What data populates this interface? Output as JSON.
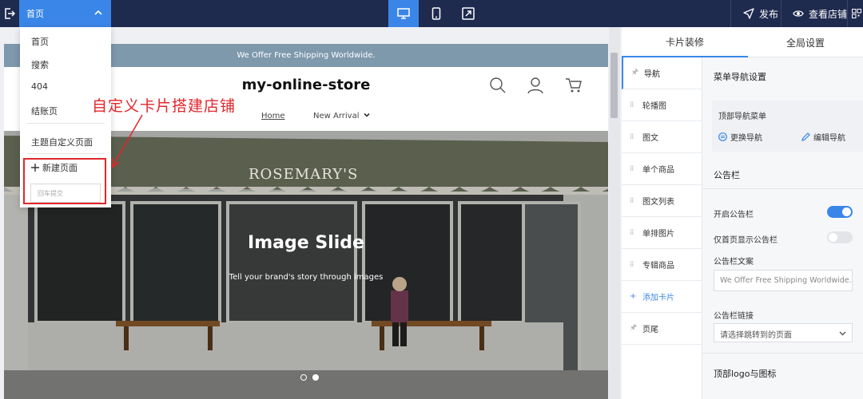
{
  "topbar": {
    "current_page": "首页",
    "publish_label": "发布",
    "view_store_label": "查看店铺",
    "icons": {
      "exit": "exit-icon",
      "desktop": "desktop-icon",
      "mobile": "mobile-icon",
      "fullscreen": "fullscreen-icon",
      "publish": "send-icon",
      "view": "eye-icon",
      "qr": "qr-icon"
    }
  },
  "dropdown": {
    "items": [
      "首页",
      "搜索",
      "404",
      "结账页"
    ],
    "theme_custom": "主题自定义页面",
    "new_page": "新建页面",
    "new_page_placeholder": "回车提交"
  },
  "annotation": "自定义卡片搭建店铺",
  "preview": {
    "announcement": "We Offer Free Shipping Worldwide.",
    "store_name": "my-online-store",
    "nav": [
      "Home",
      "New Arrival"
    ],
    "hero_title": "Image Slide",
    "hero_subtitle": "Tell your brand's story through images",
    "sign_text": "ROSEMARY'S",
    "slides_total": 2,
    "slide_active": 2
  },
  "panel": {
    "tabs": [
      "卡片装修",
      "全局设置"
    ],
    "active_tab": 0,
    "cards": [
      {
        "label": "导航",
        "icon": "pin-icon"
      },
      {
        "label": "轮播图",
        "icon": "drag-icon"
      },
      {
        "label": "图文",
        "icon": "drag-icon"
      },
      {
        "label": "单个商品",
        "icon": "drag-icon"
      },
      {
        "label": "图文列表",
        "icon": "drag-icon"
      },
      {
        "label": "单排图片",
        "icon": "drag-icon"
      },
      {
        "label": "专辑商品",
        "icon": "drag-icon"
      },
      {
        "label": "添加卡片",
        "icon": "plus-icon"
      },
      {
        "label": "页尾",
        "icon": "pin-icon"
      }
    ],
    "settings": {
      "menu_title": "菜单导航设置",
      "top_nav_menu": "顶部导航菜单",
      "change_nav": "更换导航",
      "edit_nav": "编辑导航",
      "announcement_section": "公告栏",
      "enable_announcement": "开启公告栏",
      "enable_on": true,
      "homepage_only": "仅首页显示公告栏",
      "homepage_only_on": false,
      "announcement_text_label": "公告栏文案",
      "announcement_text_value": "We Offer Free Shipping Worldwide.",
      "announcement_link_label": "公告栏链接",
      "announcement_link_placeholder": "请选择跳转到的页面",
      "logo_section": "顶部logo与图标"
    }
  },
  "colors": {
    "topbar": "#1f2a4f",
    "accent": "#3a86e8",
    "announcement_bg": "#7e98ac",
    "annotation_red": "#e0262b"
  }
}
